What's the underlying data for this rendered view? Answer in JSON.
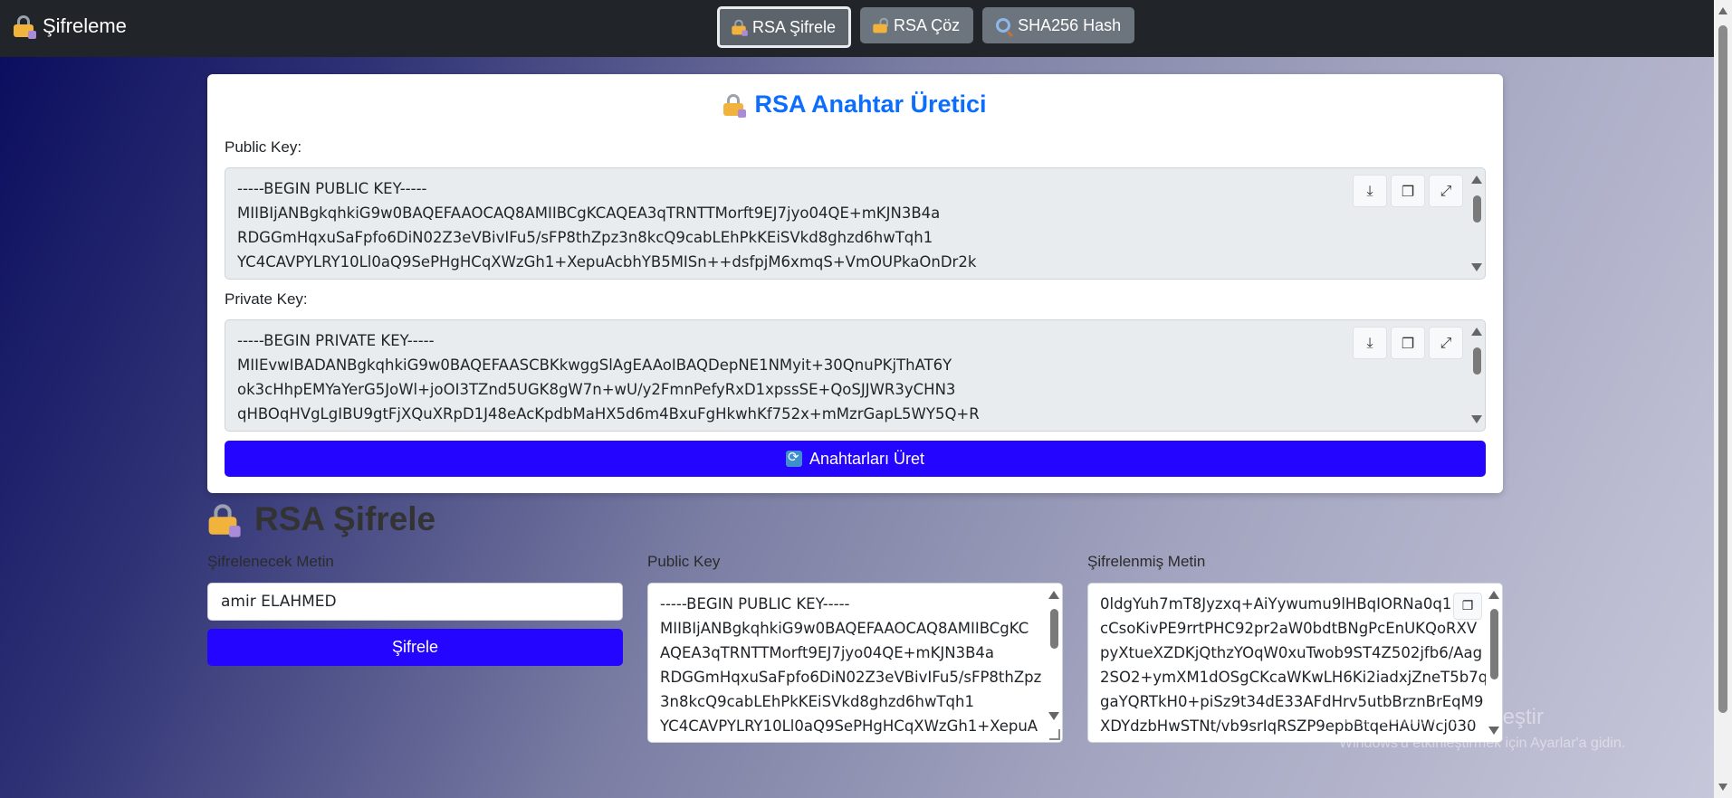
{
  "brand": {
    "title": "Şifreleme",
    "icon": "lock-pen-icon"
  },
  "nav": {
    "items": [
      {
        "label": "RSA Şifrele",
        "icon": "lock-pen-icon",
        "active": true
      },
      {
        "label": "RSA Çöz",
        "icon": "unlock-icon",
        "active": false
      },
      {
        "label": "SHA256 Hash",
        "icon": "magnifier-icon",
        "active": false
      }
    ]
  },
  "generator": {
    "title": "RSA Anahtar Üretici",
    "public_label": "Public Key:",
    "private_label": "Private Key:",
    "public_key_lines": [
      "-----BEGIN PUBLIC KEY-----",
      "MIIBIjANBgkqhkiG9w0BAQEFAAOCAQ8AMIIBCgKCAQEA3qTRNTTMorft9EJ7jyo04QE+mKJN3B4a",
      "RDGGmHqxuSaFpfo6DiN02Z3eVBivIFu5/sFP8thZpz3n8kcQ9cabLEhPkKEiSVkd8ghzd6hwTqh1",
      "YC4CAVPYLRY10Ll0aQ9SePHgHCqXWzGh1+XepuAcbhYB5MISn++dsfpjM6xmqS+VmOUPkaOnDr2k"
    ],
    "private_key_lines": [
      "-----BEGIN PRIVATE KEY-----",
      "MIIEvwIBADANBgkqhkiG9w0BAQEFAASCBKkwggSlAgEAAoIBAQDepNE1NMyit+30QnuPKjThAT6Y",
      "ok3cHhpEMYaYerG5JoWl+joOI3TZnd5UGK8gW7n+wU/y2FmnPefyRxD1xpssSE+QoSJJWR3yCHN3",
      "qHBOqHVgLgIBU9gtFjXQuXRpD1J48eAcKpdbMaHX5d6m4BxuFgHkwhKf752x+mMzrGapL5WY5Q+R"
    ],
    "generate_label": "Anahtarları Üret"
  },
  "encrypt": {
    "title": "RSA Şifrele",
    "plain_label": "Şifrelenecek Metin",
    "plain_value": "amir ELAHMED",
    "encrypt_button": "Şifrele",
    "pub_label": "Public Key",
    "pub_lines": [
      "-----BEGIN PUBLIC KEY-----",
      "MIIBIjANBgkqhkiG9w0BAQEFAAOCAQ8AMIIBCgKC",
      "AQEA3qTRNTTMorft9EJ7jyo04QE+mKJN3B4a",
      "RDGGmHqxuSaFpfo6DiN02Z3eVBivIFu5/sFP8thZpz",
      "3n8kcQ9cabLEhPkKEiSVkd8ghzd6hwTqh1",
      "YC4CAVPYLRY10Ll0aQ9SePHgHCqXWzGh1+XepuA"
    ],
    "cipher_label": "Şifrelenmiş Metin",
    "cipher_lines": [
      "0ldgYuh7mT8Jyzxq+AiYywumu9lHBqIORNa0q1I",
      "cCsoKivPE9rrtPHC92pr2aW0bdtBNgPcEnUKQoRXV",
      "pyXtueXZDKjQthzYOqW0xuTwob9ST4Z502jfb6/Aag",
      "2SO2+ymXM1dOSgCKcaWKwLH6Ki2iadxjZneT5b7q",
      "gaYQRTkH0+piSz9t34dE33AFdHrv5utbBrznBrEqM9",
      "XDYdzbHwSTNt/vb9srIqRSZP9epbBtqeHAUWcj030"
    ]
  },
  "watermark": {
    "line1": "Windows'u Etkinleştir",
    "line2": "Windows'u etkinleştirmek için Ayarlar'a gidin."
  },
  "colors": {
    "primary": "#2405ff",
    "accent": "#0d6efd",
    "navbar": "#212529"
  }
}
